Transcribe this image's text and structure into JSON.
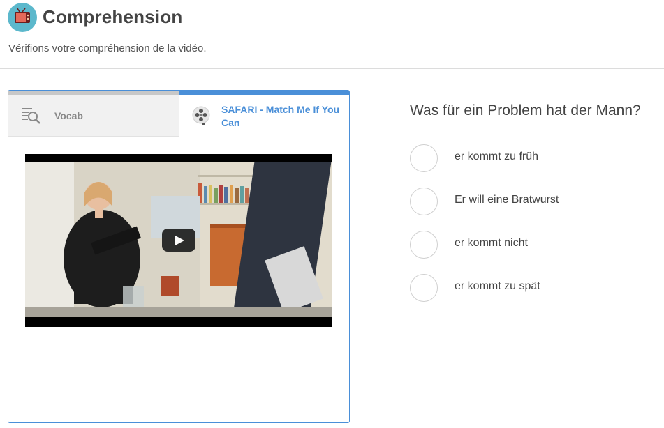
{
  "header": {
    "title": "Comprehension",
    "subtitle": "Vérifions votre compréhension de la vidéo.",
    "logo_icon": "tv-icon"
  },
  "tabs": [
    {
      "label": "Vocab",
      "icon": "magnifier-list-icon",
      "active": false
    },
    {
      "label": "SAFARI - Match Me If You Can",
      "icon": "film-reel-icon",
      "active": true
    }
  ],
  "video": {
    "play_icon": "play-icon"
  },
  "quiz": {
    "question": "Was für ein Problem hat der Mann?",
    "options": [
      {
        "label": "er kommt zu früh"
      },
      {
        "label": "Er will eine Bratwurst"
      },
      {
        "label": "er kommt nicht"
      },
      {
        "label": "er kommt zu spät"
      }
    ]
  },
  "colors": {
    "accent": "#4a8fd8",
    "logo_bg": "#5cb8cc",
    "text": "#444444"
  }
}
